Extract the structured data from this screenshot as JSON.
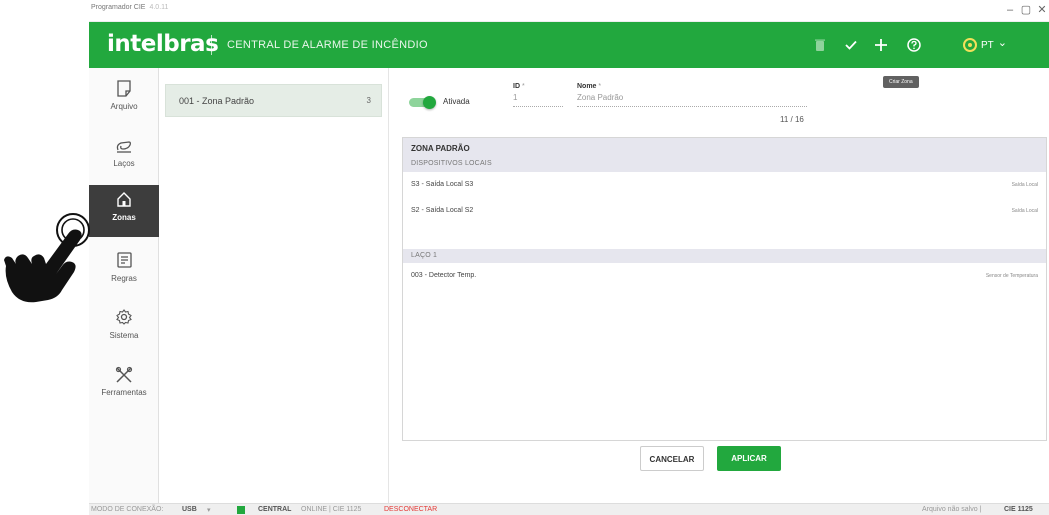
{
  "window": {
    "app_title": "Programador CIE",
    "version": "4.0.11",
    "minimize": "–",
    "maximize": "▢",
    "close": "✕"
  },
  "header": {
    "logo": "intelbras",
    "title": "CENTRAL DE ALARME DE INCÊNDIO",
    "lang": "PT",
    "lang_caret": "⌄",
    "icons": [
      "delete-icon",
      "check-icon",
      "add-icon",
      "help-icon",
      "language-icon"
    ],
    "tooltip": "Criar Zona"
  },
  "sidebar": {
    "items": [
      {
        "label": "Arquivo",
        "icon": "file-icon"
      },
      {
        "label": "Laços",
        "icon": "loop-icon"
      },
      {
        "label": "Zonas",
        "icon": "home-icon",
        "active": true
      },
      {
        "label": "Regras",
        "icon": "rules-icon"
      },
      {
        "label": "Sistema",
        "icon": "gear-icon"
      },
      {
        "label": "Ferramentas",
        "icon": "tools-icon"
      }
    ]
  },
  "zones": {
    "items": [
      {
        "name": "001 - Zona Padrão",
        "count": "3"
      }
    ]
  },
  "form": {
    "toggle_label": "Ativada",
    "toggle_on": true,
    "id_label": "ID",
    "id_value": "1",
    "name_label": "Nome",
    "name_value": "Zona Padrão",
    "required_mark": "*",
    "counter": "11 / 16"
  },
  "panel": {
    "title": "ZONA PADRÃO",
    "sections": [
      {
        "title": "DISPOSITIVOS LOCAIS",
        "rows": [
          {
            "name": "S3 - Saída Local S3",
            "type": "Saída Local"
          },
          {
            "name": "S2 - Saída Local S2",
            "type": "Saída Local"
          }
        ]
      },
      {
        "title": "LAÇO 1",
        "rows": [
          {
            "name": "003 - Detector Temp.",
            "type": "Sensor de Temperatura"
          }
        ]
      }
    ]
  },
  "buttons": {
    "cancel": "CANCELAR",
    "apply": "APLICAR"
  },
  "statusbar": {
    "mode_label": "MODO DE CONEXÃO:",
    "connection": "USB",
    "dropdown": "▾",
    "central": "CENTRAL",
    "status": "ONLINE | CIE 1125",
    "disconnect": "DESCONECTAR",
    "right_text": "Arquivo não salvo |",
    "right_model": "CIE 1125"
  },
  "colors": {
    "brand_green": "#22a83e",
    "sidebar_active": "#3d3d3d",
    "disconnect_red": "#e53935"
  }
}
